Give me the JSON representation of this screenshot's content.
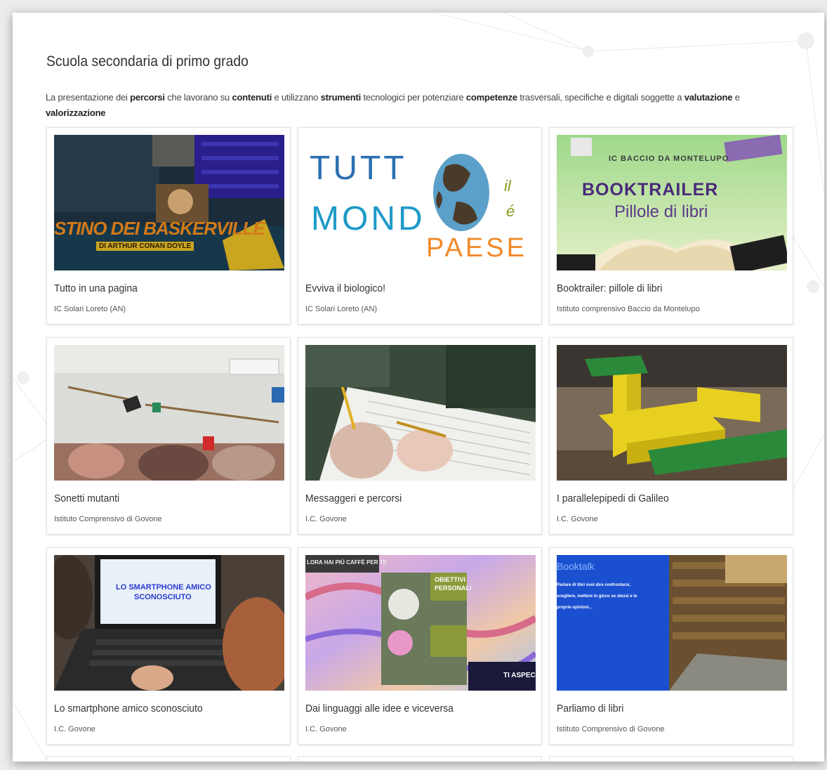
{
  "section": {
    "title": "Scuola secondaria di primo grado",
    "desc_parts": [
      "La presentazione dei ",
      "percorsi",
      " che lavorano su ",
      "contenuti",
      " e utilizzano ",
      "strumenti",
      " tecnologici per potenziare ",
      "competenze",
      " trasversali, specifiche e digitali soggette a ",
      "valutazione",
      " e ",
      "valorizzazione"
    ]
  },
  "cards": [
    {
      "title": "Tutto in una pagina",
      "school": "IC Solari Loreto (AN)",
      "thumb_text": [
        "STINO DEI BASKERVILLE",
        "DI ARTHUR CONAN DOYLE"
      ]
    },
    {
      "title": "Evviva il biologico!",
      "school": "IC Solari Loreto (AN)",
      "thumb_text": [
        "TUTT",
        "MOND",
        "PAESE",
        "il",
        "é"
      ]
    },
    {
      "title": "Booktrailer: pillole di libri",
      "school": "Istituto comprensivo Baccio da Montelupo",
      "thumb_text": [
        "IC BACCIO DA MONTELUPO",
        "BOOKTRAILER",
        "Pillole di libri"
      ]
    },
    {
      "title": "Sonetti mutanti",
      "school": "Istituto Comprensivo di Govone",
      "thumb_text": []
    },
    {
      "title": "Messaggeri e percorsi",
      "school": "I.C. Govone",
      "thumb_text": []
    },
    {
      "title": "I parallelepipedi di Galileo",
      "school": "I.C. Govone",
      "thumb_text": []
    },
    {
      "title": "Lo smartphone amico sconosciuto",
      "school": "I.C. Govone",
      "thumb_text": [
        "LO SMARTPHONE AMICO",
        "SCONOSCIUTO"
      ]
    },
    {
      "title": "Dai linguaggi alle idee e viceversa",
      "school": "I.C. Govone",
      "thumb_text": [
        "LORA HAI PIÙ CAFFÈ PER TE",
        "OBIETTIVI",
        "PERSONALI",
        "TI ASPEC"
      ]
    },
    {
      "title": "Parliamo di libri",
      "school": "Istituto Comprensivo di Govone",
      "thumb_text": [
        "Booktalk",
        "Parlare di libri vuol dire confrontarsi,",
        "scegliere, mettere in gioco se stessi e le",
        "proprie opinioni..."
      ]
    }
  ],
  "colors": {
    "panel_bg": "#ffffff",
    "page_bg": "#ececec",
    "title_text": "#333333",
    "booktalk_blue": "#1a4fd0",
    "booktrailer_purple": "#4a2a7a"
  }
}
